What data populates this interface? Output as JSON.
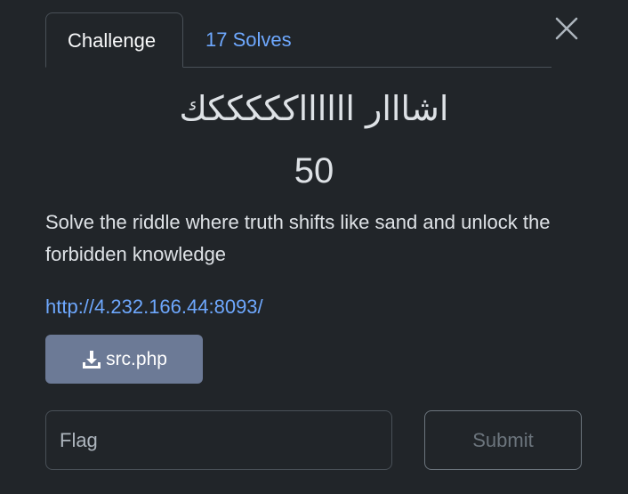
{
  "tabs": [
    {
      "label": "Challenge",
      "active": true
    },
    {
      "label": "17 Solves",
      "active": false
    }
  ],
  "challenge": {
    "title": "اشااار ااااااكككككك",
    "points": "50",
    "description": "Solve the riddle where truth shifts like sand and unlock the forbidden knowledge",
    "link": "http://4.232.166.44:8093/",
    "file": {
      "label": "src.php",
      "icon": "download-icon"
    }
  },
  "form": {
    "flag_placeholder": "Flag",
    "submit_label": "Submit"
  },
  "close": {
    "icon": "close-icon"
  },
  "colors": {
    "background": "#212529",
    "link": "#6ea8fe",
    "file_button": "#6c7a96",
    "border": "#495057"
  }
}
